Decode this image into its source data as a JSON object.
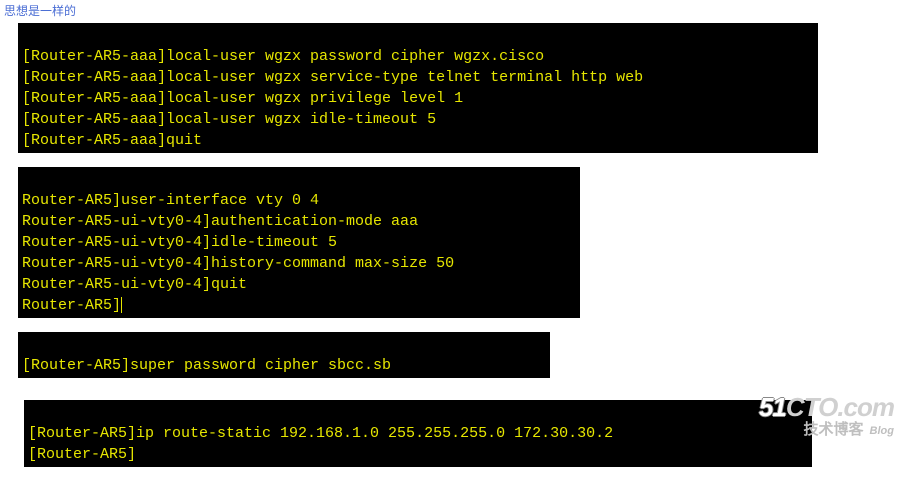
{
  "header_text": "思想是一样的",
  "term1": [
    "[Router-AR5-aaa]local-user wgzx password cipher wgzx.cisco",
    "[Router-AR5-aaa]local-user wgzx service-type telnet terminal http web",
    "[Router-AR5-aaa]local-user wgzx privilege level 1",
    "[Router-AR5-aaa]local-user wgzx idle-timeout 5",
    "[Router-AR5-aaa]quit"
  ],
  "term2": [
    "Router-AR5]user-interface vty 0 4",
    "Router-AR5-ui-vty0-4]authentication-mode aaa",
    "Router-AR5-ui-vty0-4]idle-timeout 5",
    "Router-AR5-ui-vty0-4]history-command max-size 50",
    "Router-AR5-ui-vty0-4]quit",
    "Router-AR5]"
  ],
  "term3": [
    "[Router-AR5]super password cipher sbcc.sb"
  ],
  "term4": [
    "[Router-AR5]ip route-static 192.168.1.0 255.255.255.0 172.30.30.2",
    "[Router-AR5]"
  ],
  "watermark": {
    "p1": "51",
    "p2": "CTO",
    "p3": ".com",
    "sub": "技术博客",
    "blog": "Blog"
  }
}
